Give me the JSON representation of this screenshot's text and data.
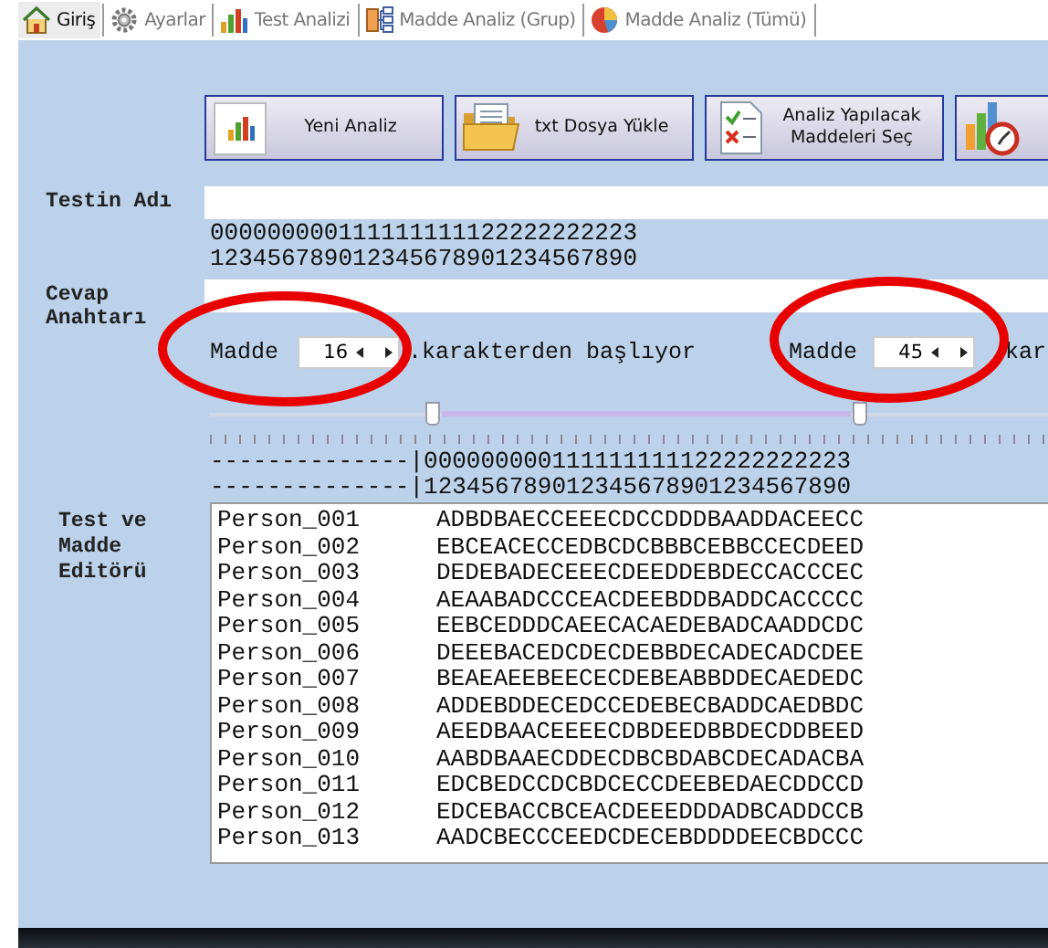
{
  "tabs": [
    {
      "label": "Giriş",
      "selected": true
    },
    {
      "label": "Ayarlar",
      "selected": false
    },
    {
      "label": "Test Analizi",
      "selected": false
    },
    {
      "label": "Madde Analiz (Grup)",
      "selected": false
    },
    {
      "label": "Madde Analiz (Tümü)",
      "selected": false
    }
  ],
  "toolbar": [
    {
      "label": "Yeni Analiz"
    },
    {
      "label": "txt Dosya Yükle"
    },
    {
      "label": "Analiz Yapılacak Maddeleri Seç"
    }
  ],
  "test_name": {
    "label": "Testin Adı"
  },
  "column_ruler": [
    "000000000111111111122222222223",
    "123456789012345678901234567890"
  ],
  "answer_key": {
    "label": "Cevap Anahtarı"
  },
  "item_range": [
    {
      "label": "Madde",
      "value": "16",
      "suffix": ".karakterden başlıyor"
    },
    {
      "label": "Madde",
      "value": "45",
      "suffix": "kar"
    }
  ],
  "slider": {
    "thumbs": [
      {
        "level": 0.266
      },
      {
        "level": 0.776
      }
    ]
  },
  "data_ruler": [
    "--------------|000000000111111111122222222223",
    "--------------|123456789012345678901234567890"
  ],
  "editor": {
    "label": "Test ve Madde Editörü",
    "rows": [
      {
        "id": "Person_001",
        "answers": "ADBDBAECCEEECDCCDDDBAADDACEECC"
      },
      {
        "id": "Person_002",
        "answers": "EBCEACECCEDBCDCBBBCEBBCCECDEED"
      },
      {
        "id": "Person_003",
        "answers": "DEDEBADECEEECDEEDDEBDECCACCCEC"
      },
      {
        "id": "Person_004",
        "answers": "AEAABADCCCEACDEEBDDBADDCACCCCC"
      },
      {
        "id": "Person_005",
        "answers": "EEBCEDDDCAEECACAEDEBADCAADDCDC"
      },
      {
        "id": "Person_006",
        "answers": "DEEEBACEDCDECDEBBDECADECADCDEE"
      },
      {
        "id": "Person_007",
        "answers": "BEAEAEEBEECECDEBEABBDDECAEDEDC"
      },
      {
        "id": "Person_008",
        "answers": "ADDEBDDECEDCCEDEBECBADDCAEDBDC"
      },
      {
        "id": "Person_009",
        "answers": "AEEDBAACEEEECDBDEEDBBDECDDBEED"
      },
      {
        "id": "Person_010",
        "answers": "AABDBAAECDDECDBCBDABCDECADACBA"
      },
      {
        "id": "Person_011",
        "answers": "EDCBEDCCDCBDCECCDEEBEDAECDDCCD"
      },
      {
        "id": "Person_012",
        "answers": "EDCEBACCBCEACDEEEDDDADBCADDCCB"
      },
      {
        "id": "Person_013",
        "answers": "AADCBECCCEEDCDECEBDDDDEECBDCCC"
      }
    ]
  }
}
